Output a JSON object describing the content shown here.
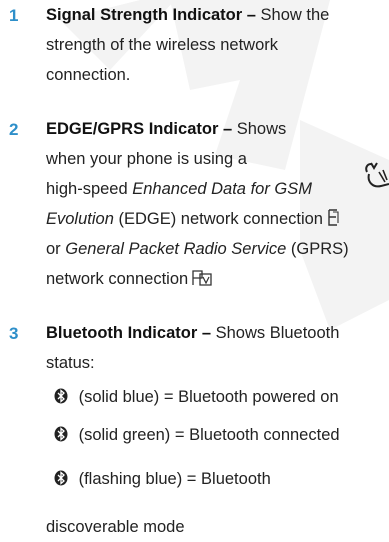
{
  "items": [
    {
      "number": "1",
      "title": "Signal Strength Indicator –",
      "text_a": " Show the",
      "line2": "strength of the wireless network",
      "line3": "connection."
    },
    {
      "number": "2",
      "title": "EDGE/GPRS Indicator –",
      "text_a": " Shows",
      "line2": "when your phone is using a",
      "line3": "high-speed ",
      "line3_it": "Enhanced Data for GSM",
      "line4_it": "Evolution",
      "line4": " (EDGE) network connection",
      "line5_pre": "or ",
      "line5_it": "General Packet Radio Service",
      "line5": " (GPRS)",
      "line6": "network connection"
    },
    {
      "number": "3",
      "title": "Bluetooth Indicator –",
      "text_a": " Shows Bluetooth",
      "line2": "status:",
      "states": [
        {
          "icon": "bluetooth-icon",
          "color": "#2d72b8",
          "label": " (solid blue) = Bluetooth powered on"
        },
        {
          "icon": "bluetooth-icon",
          "color": "#2b9a48",
          "label": " (solid green) = Bluetooth connected"
        },
        {
          "icon": "bluetooth-icon",
          "color": "#2d72b8",
          "label": " (flashing blue) = Bluetooth"
        }
      ],
      "state3_cont": "discoverable mode"
    }
  ],
  "icons": {
    "edge": "edge-network-icon",
    "gprs": "gprs-network-icon",
    "margin_mark": "feature-note-icon"
  }
}
